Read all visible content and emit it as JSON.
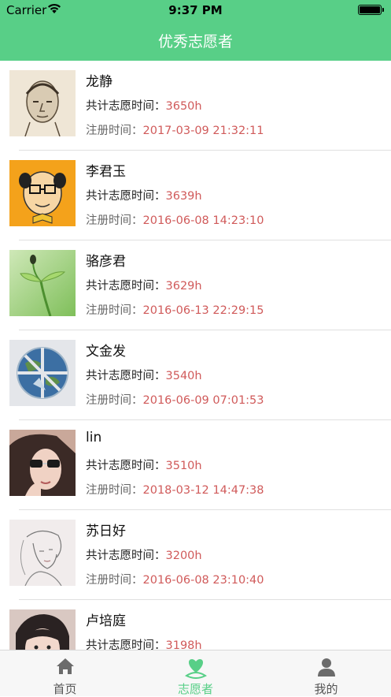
{
  "status_bar": {
    "carrier": "Carrier",
    "time": "9:37 PM"
  },
  "header": {
    "title": "优秀志愿者"
  },
  "labels": {
    "total_hours": "共计志愿时间：",
    "register_time": "注册时间："
  },
  "volunteers": [
    {
      "name": "龙静",
      "hours": "3650h",
      "registered": "2017-03-09 21:32:11",
      "avatar": "sketch-portrait"
    },
    {
      "name": "李君玉",
      "hours": "3639h",
      "registered": "2016-06-08 14:23:10",
      "avatar": "cartoon-man"
    },
    {
      "name": "骆彦君",
      "hours": "3629h",
      "registered": "2016-06-13 22:29:15",
      "avatar": "green-sprout"
    },
    {
      "name": "文金发",
      "hours": "3540h",
      "registered": "2016-06-09 07:01:53",
      "avatar": "earth-pieces"
    },
    {
      "name": "lin",
      "hours": "3510h",
      "registered": "2018-03-12 14:47:38",
      "avatar": "woman-sunglasses"
    },
    {
      "name": "苏日好",
      "hours": "3200h",
      "registered": "2016-06-08 23:10:40",
      "avatar": "sketch-girl"
    },
    {
      "name": "卢培庭",
      "hours": "3198h",
      "registered": "",
      "avatar": "girl-photo"
    }
  ],
  "tabs": [
    {
      "label": "首页",
      "icon": "home-icon",
      "active": false
    },
    {
      "label": "志愿者",
      "icon": "heart-hand-icon",
      "active": true
    },
    {
      "label": "我的",
      "icon": "person-icon",
      "active": false
    }
  ],
  "colors": {
    "accent": "#58cf87",
    "value_red": "#d05a5a"
  }
}
